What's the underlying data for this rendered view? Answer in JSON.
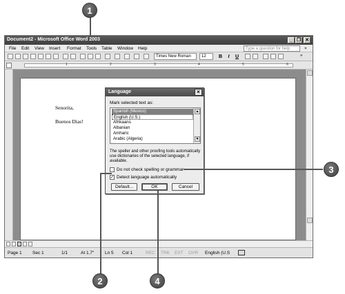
{
  "window": {
    "title": "Document2 - Microsoft Office Word 2003",
    "controls": [
      "_",
      "❐",
      "✕"
    ]
  },
  "menubar": {
    "items": [
      "File",
      "Edit",
      "View",
      "Insert",
      "Format",
      "Tools",
      "Table",
      "Window",
      "Help"
    ],
    "ask_placeholder": "Type a question for help",
    "close": "×"
  },
  "toolbar": {
    "font": "Times New Roman",
    "size": "12",
    "bold": "B",
    "italic": "I",
    "underline": "U"
  },
  "ruler": {
    "numbers": [
      "1",
      "2",
      "3",
      "4",
      "5",
      "6"
    ]
  },
  "document": {
    "line1": "Senorita,",
    "line2": "Buenos Dias!"
  },
  "statusbar": {
    "page": "Page 1",
    "sec": "Sec 1",
    "pages": "1/1",
    "at": "At 1.7\"",
    "ln": "Ln 5",
    "col": "Col 1",
    "rec": "REC",
    "trk": "TRK",
    "ext": "EXT",
    "ovr": "OVR",
    "language": "English (U.S"
  },
  "dialog": {
    "title": "Language",
    "mark_label": "Mark selected text as:",
    "languages": [
      "Spanish (Mexico)",
      "English (U.S.)",
      "Afrikaans",
      "Albanian",
      "Amharic",
      "Arabic (Algeria)"
    ],
    "selected_index": 0,
    "description": "The speller and other proofing tools automatically use dictionaries of the selected language, if available.",
    "checkbox_no_spell": "Do not check spelling or grammar",
    "checkbox_detect": "Detect language automatically",
    "no_spell_checked": false,
    "detect_checked": true,
    "default_button": "Default...",
    "ok_button": "OK",
    "cancel_button": "Cancel"
  },
  "callouts": [
    "1",
    "2",
    "3",
    "4"
  ]
}
